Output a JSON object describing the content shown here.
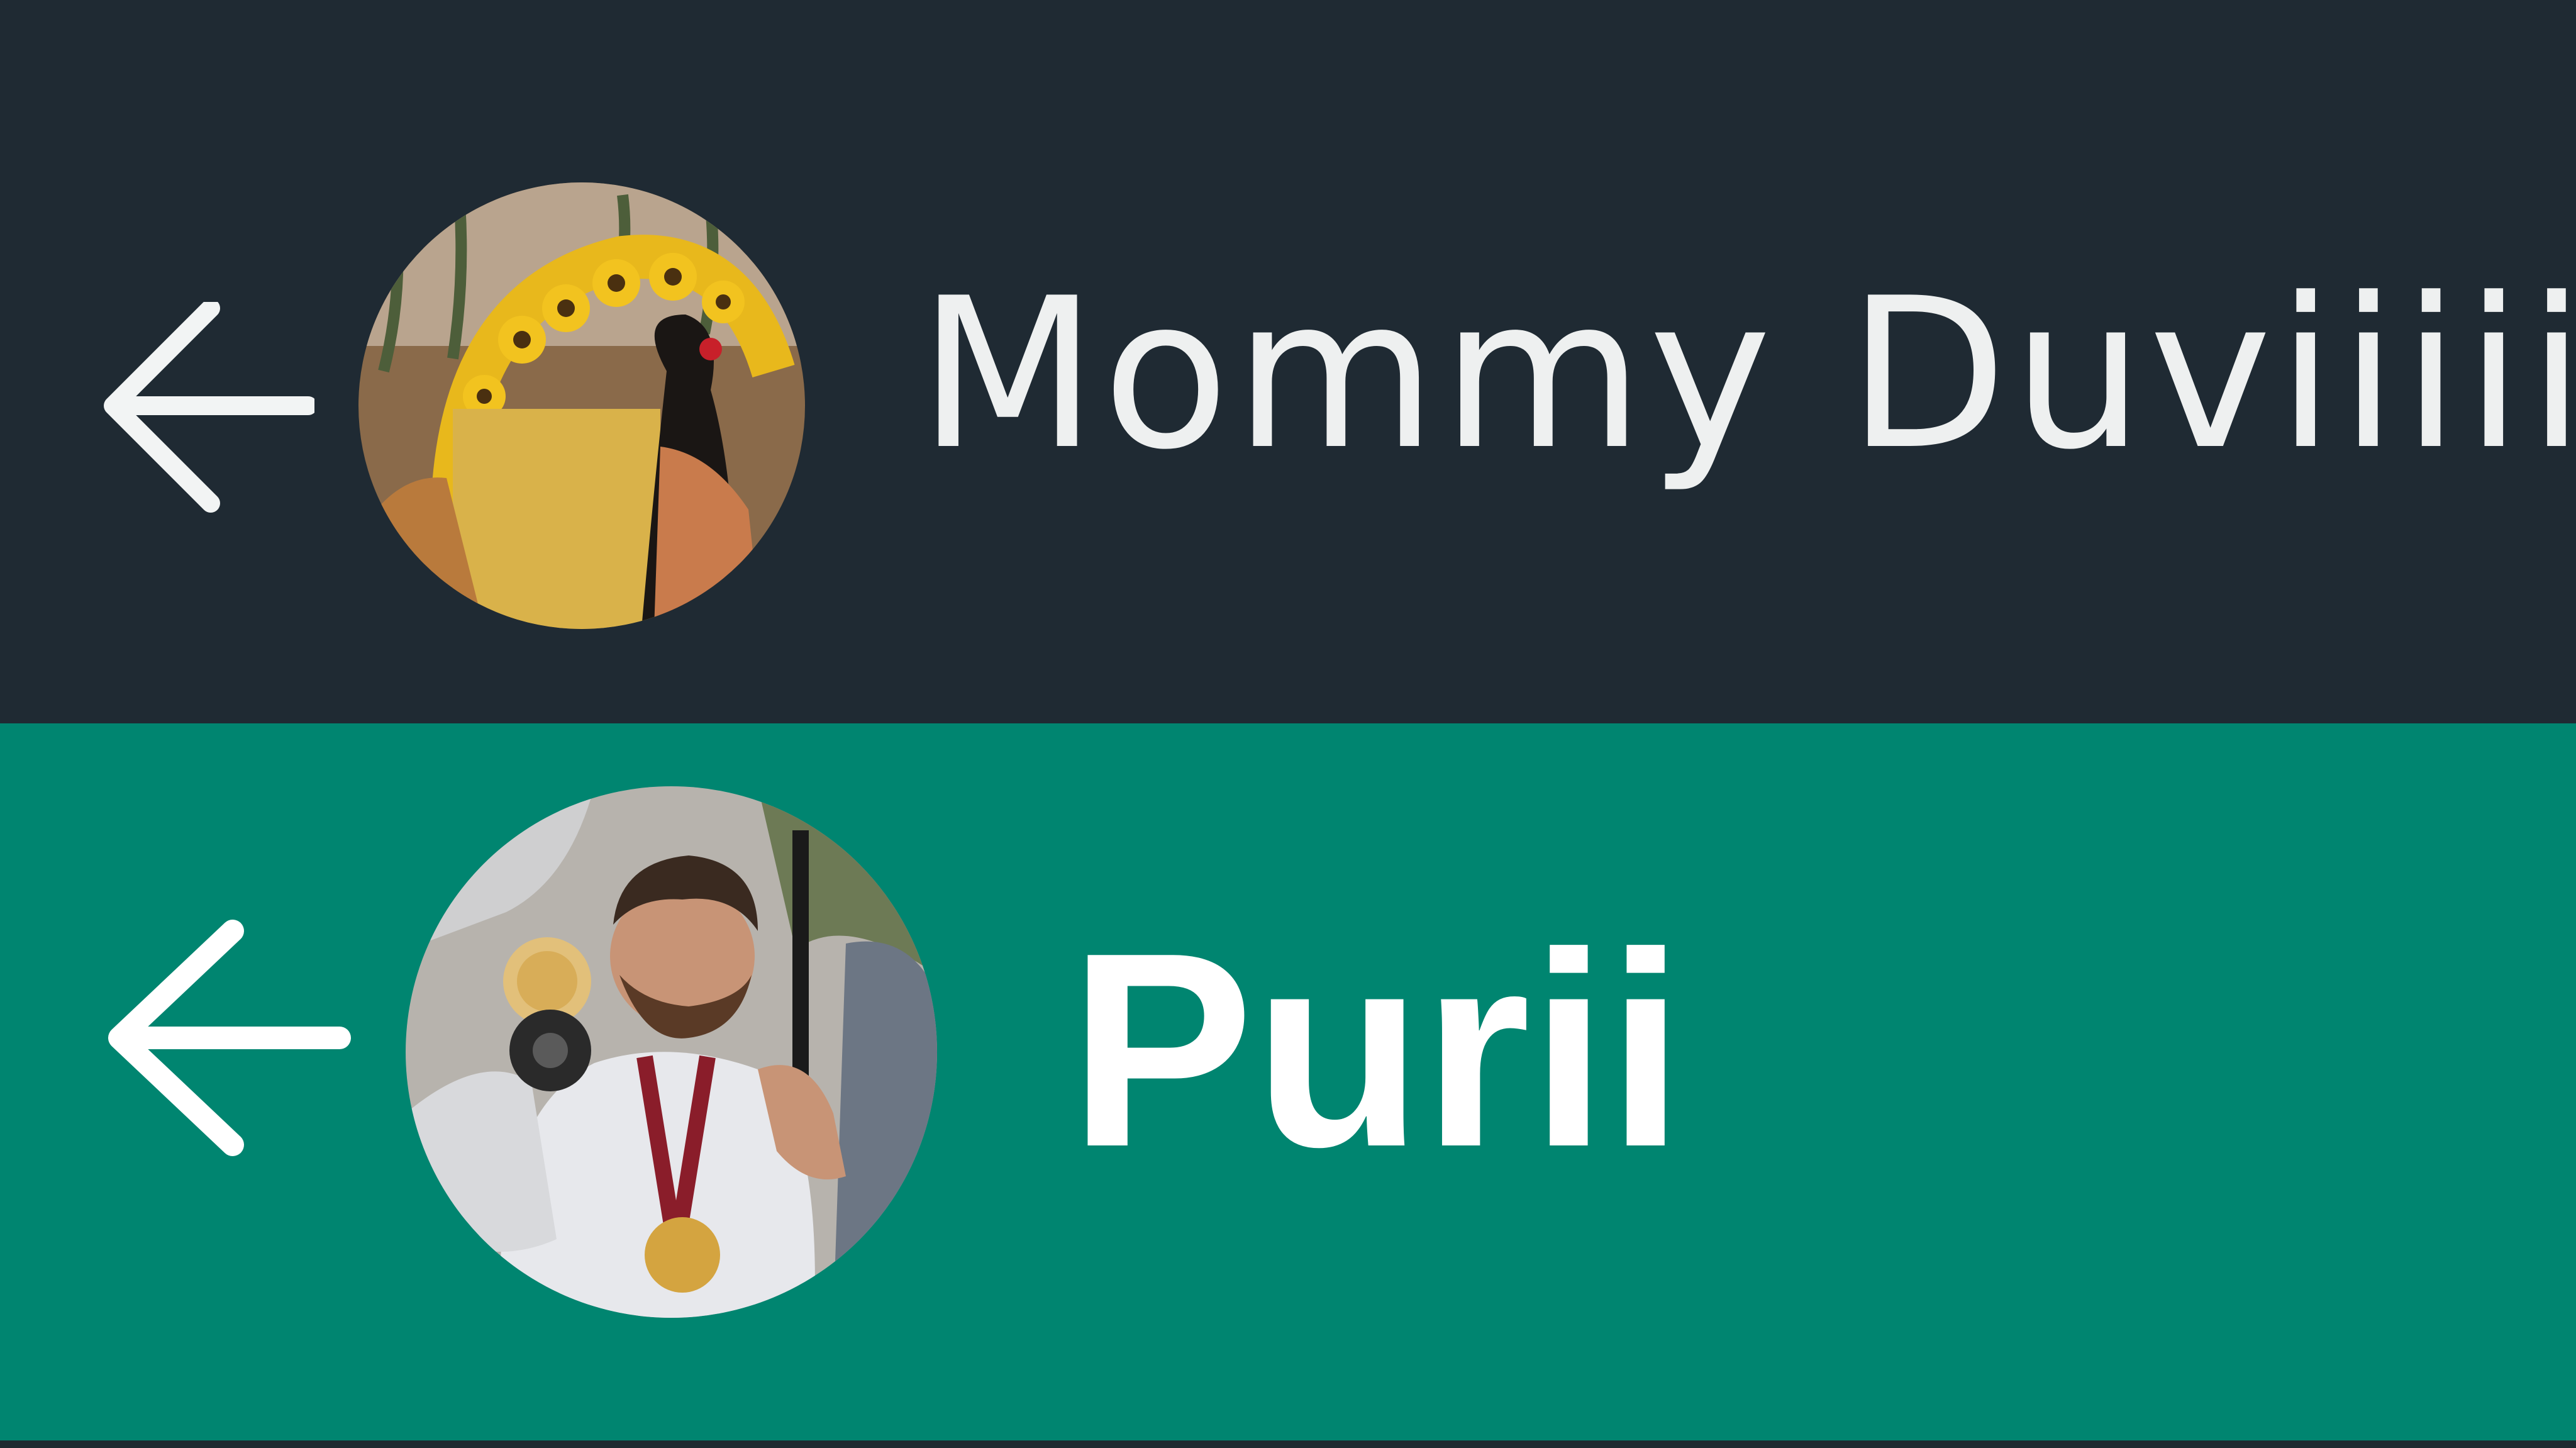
{
  "colors": {
    "top_bar_background": "#1f2a33",
    "bottom_bar_background": "#008570",
    "text": "#ffffff",
    "icon": "#ffffff"
  },
  "headers": [
    {
      "back_icon": "arrow-left-icon",
      "avatar": "profile-photo-woman-sunflowers",
      "name": "Mommy Duviiiii"
    },
    {
      "back_icon": "arrow-left-icon",
      "avatar": "profile-photo-man-medal",
      "name": "Purii"
    }
  ]
}
